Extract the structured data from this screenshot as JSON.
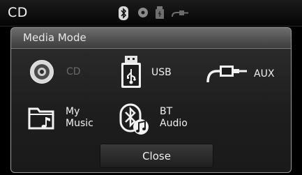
{
  "status_bar": {
    "title": "CD",
    "icons": [
      "bluetooth-icon",
      "cd-icon",
      "usb-icon",
      "aux-icon"
    ]
  },
  "popup": {
    "title": "Media Mode",
    "items": [
      {
        "id": "cd",
        "label": "CD",
        "icon": "cd-disc-icon",
        "enabled": false
      },
      {
        "id": "usb",
        "label": "USB",
        "icon": "usb-icon",
        "enabled": true
      },
      {
        "id": "aux",
        "label": "AUX",
        "icon": "aux-cable-icon",
        "enabled": true
      },
      {
        "id": "my_music",
        "label_line1": "My",
        "label_line2": "Music",
        "icon": "folder-music-icon",
        "enabled": true
      },
      {
        "id": "bt_audio",
        "label_line1": "BT",
        "label_line2": "Audio",
        "icon": "bluetooth-music-icon",
        "enabled": true
      }
    ],
    "close_label": "Close"
  },
  "colors": {
    "background": "#000000",
    "popup_border": "#9a9a9a",
    "disabled_text": "#6a6a6a",
    "text": "#f0f0f0"
  }
}
